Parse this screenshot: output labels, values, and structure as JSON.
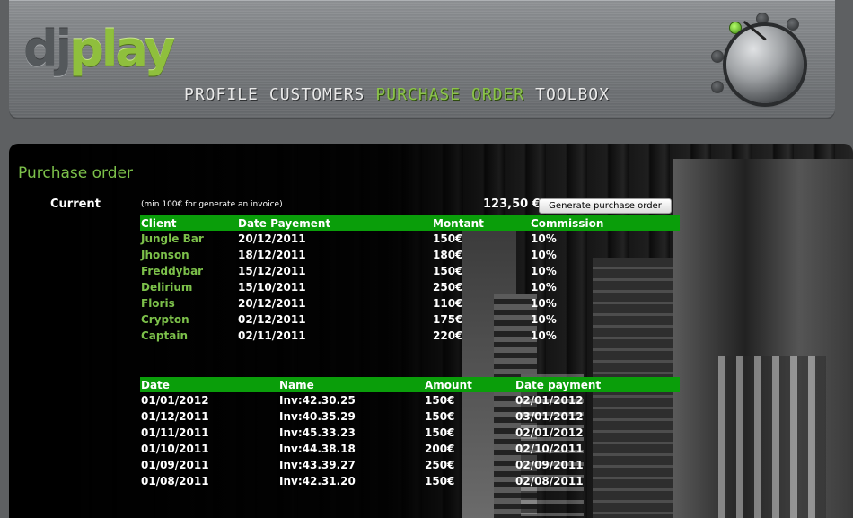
{
  "app": {
    "logo_dj": "dj",
    "logo_play": "play"
  },
  "nav": {
    "items": [
      {
        "label": "PROFILE",
        "active": false
      },
      {
        "label": "CUSTOMERS",
        "active": false
      },
      {
        "label": "PURCHASE ORDER",
        "active": true
      },
      {
        "label": "TOOLBOX",
        "active": false
      }
    ]
  },
  "page": {
    "title": "Purchase order",
    "current_label": "Current",
    "min_note": "(min 100€ for generate an invoice)",
    "total": "123,50 €",
    "generate_button": "Generate purchase order"
  },
  "orders": {
    "headers": [
      "Client",
      "Date Payement",
      "Montant",
      "Commission"
    ],
    "rows": [
      [
        "Jungle Bar",
        "20/12/2011",
        "150€",
        "10%"
      ],
      [
        "Jhonson",
        "18/12/2011",
        "180€",
        "10%"
      ],
      [
        "Freddybar",
        "15/12/2011",
        "150€",
        "10%"
      ],
      [
        "Delirium",
        "15/10/2011",
        "250€",
        "10%"
      ],
      [
        "Floris",
        "20/12/2011",
        "110€",
        "10%"
      ],
      [
        "Crypton",
        "02/12/2011",
        "175€",
        "10%"
      ],
      [
        "Captain",
        "02/11/2011",
        "220€",
        "10%"
      ]
    ]
  },
  "invoices": {
    "headers": [
      "Date",
      "Name",
      "Amount",
      "Date payment"
    ],
    "rows": [
      [
        "01/01/2012",
        "Inv:42.30.25",
        "150€",
        "02/01/2012"
      ],
      [
        "01/12/2011",
        "Inv:40.35.29",
        "150€",
        "03/01/2012"
      ],
      [
        "01/11/2011",
        "Inv:45.33.23",
        "150€",
        "02/01/2012"
      ],
      [
        "01/10/2011",
        "Inv:44.38.18",
        "200€",
        "02/10/2011"
      ],
      [
        "01/09/2011",
        "Inv:43.39.27",
        "250€",
        "02/09/2011"
      ],
      [
        "01/08/2011",
        "Inv:42.31.20",
        "150€",
        "02/08/2011"
      ]
    ]
  },
  "colors": {
    "accent_green": "#7cc04a",
    "header_green": "#0a9e0a",
    "nav_active": "#8bc34a"
  }
}
